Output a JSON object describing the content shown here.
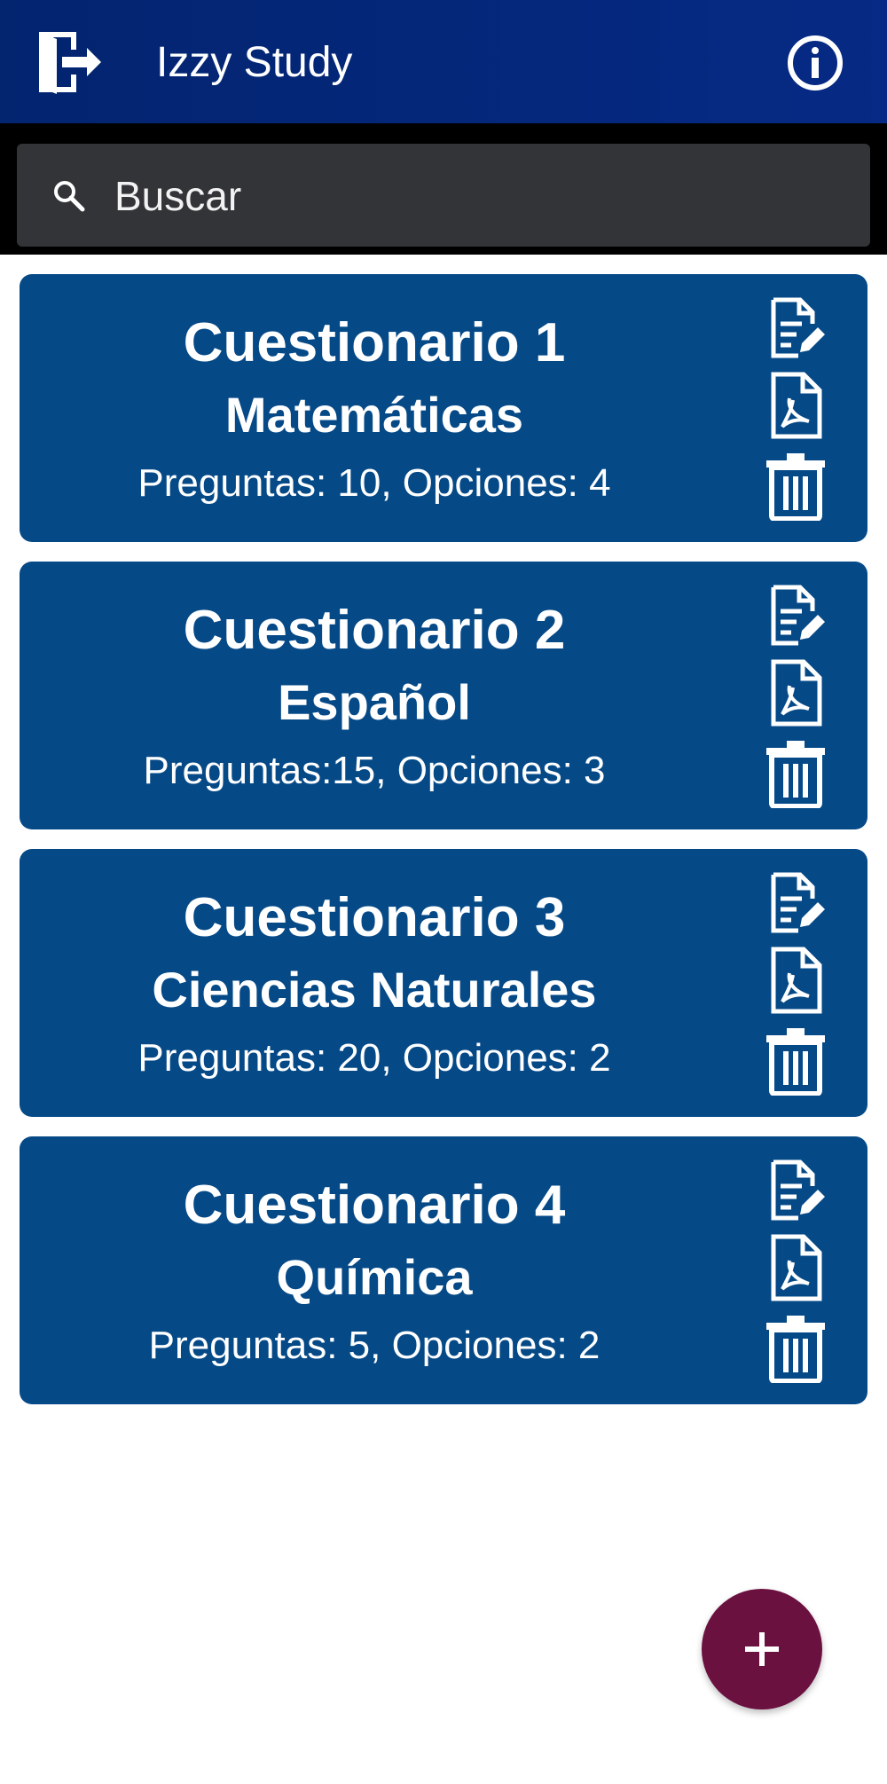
{
  "app_bar": {
    "title": "Izzy Study",
    "icons": {
      "left": "exit-icon",
      "right": "info-icon"
    },
    "color": "#03246f"
  },
  "search": {
    "placeholder": "Buscar",
    "icon": "search-icon"
  },
  "quizzes": [
    {
      "name": "Cuestionario 1",
      "subject": "Matemáticas",
      "stats": "Preguntas: 10, Opciones: 4"
    },
    {
      "name": "Cuestionario 2",
      "subject": "Español",
      "stats": "Preguntas:15, Opciones: 3"
    },
    {
      "name": "Cuestionario 3",
      "subject": "Ciencias Naturales",
      "stats": "Preguntas: 20, Opciones: 2"
    },
    {
      "name": "Cuestionario 4",
      "subject": "Química",
      "stats": "Preguntas: 5, Opciones: 2"
    }
  ],
  "card_actions": [
    "edit-document-icon",
    "pdf-icon",
    "trash-icon"
  ],
  "fab": {
    "icon": "plus-icon",
    "color": "#6b1140"
  },
  "colors": {
    "card": "#054987",
    "search_band": "#000000",
    "search_box": "#323438"
  }
}
